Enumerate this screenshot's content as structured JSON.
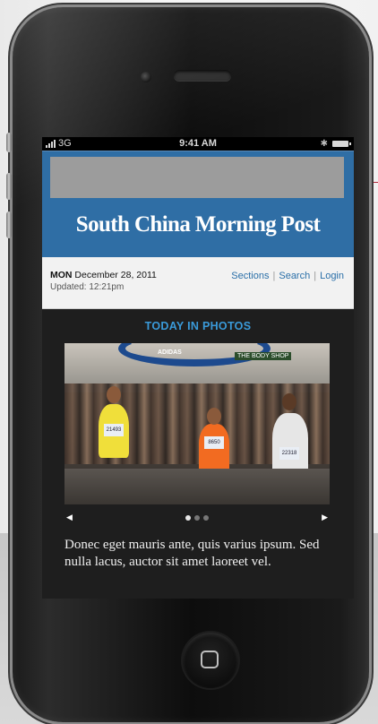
{
  "status_bar": {
    "carrier": "3G",
    "time": "9:41 AM",
    "bluetooth_icon": "bluetooth-icon",
    "battery_icon": "battery-icon"
  },
  "masthead": {
    "brand": "South China Morning Post",
    "brand_color": "#2f6ea5"
  },
  "date_bar": {
    "day": "MON",
    "date": "December 28, 2011",
    "updated": "Updated: 12:21pm",
    "nav": [
      "Sections",
      "Search",
      "Login"
    ]
  },
  "photos": {
    "title": "TODAY IN PHOTOS",
    "title_color": "#3a9ad9",
    "banner_text": "ADIDAS",
    "shop_text": "THE BODY SHOP",
    "bibs": [
      "21493",
      "8650",
      "22318"
    ],
    "dots": 3,
    "active_dot": 1,
    "caption": "Donec eget mauris ante, quis varius ipsum. Sed nulla lacus, auctor sit amet laoreet vel."
  }
}
